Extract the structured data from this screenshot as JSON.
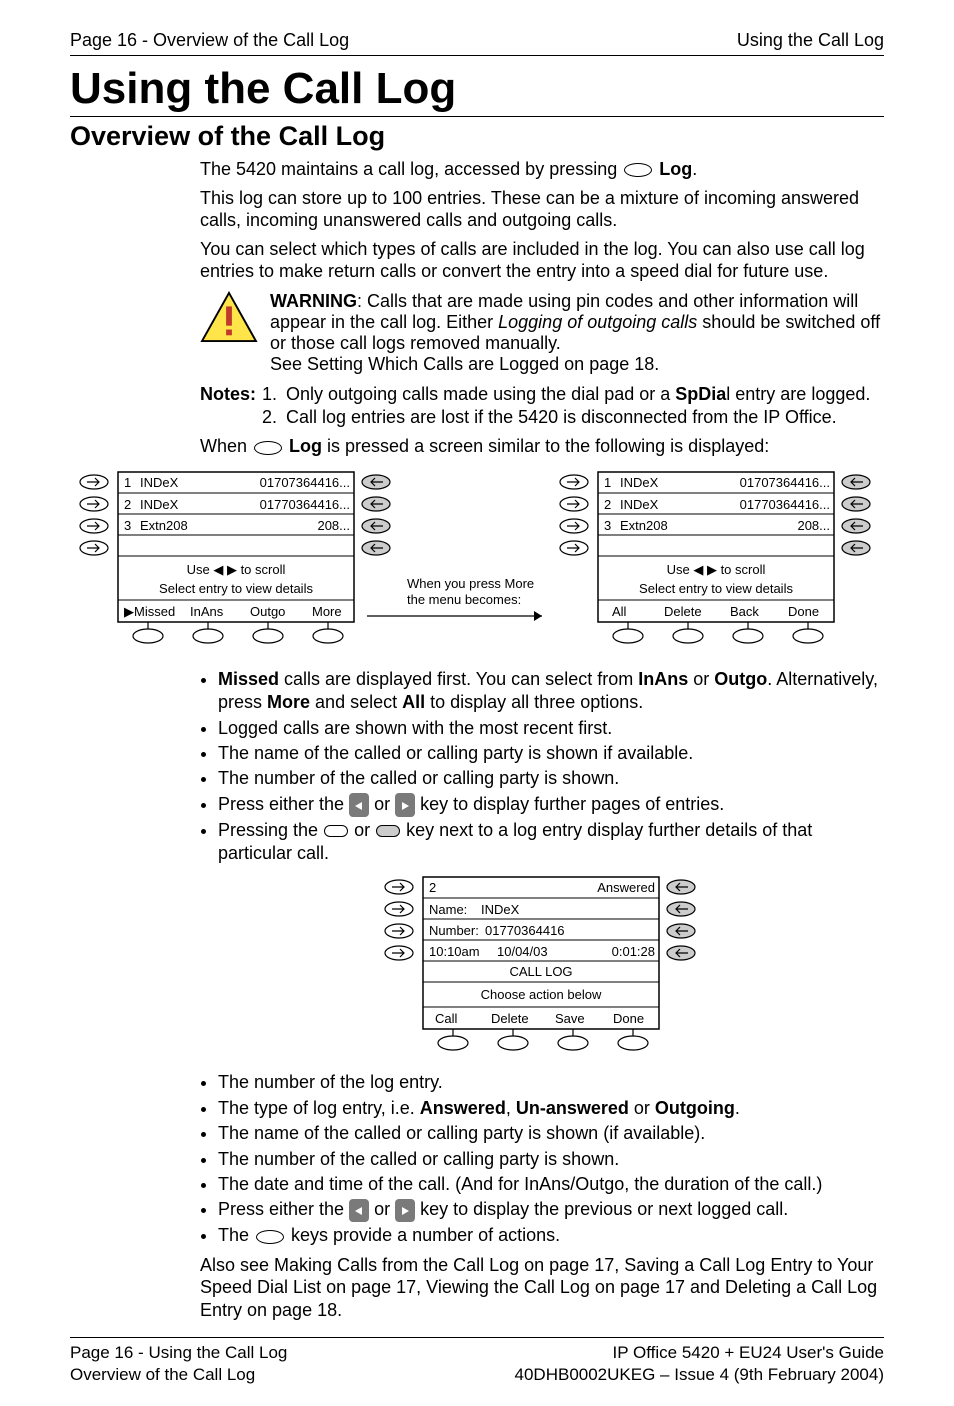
{
  "header": {
    "left": "Page 16 - Overview of the Call Log",
    "right": "Using the Call Log"
  },
  "h1": "Using the Call Log",
  "h2": "Overview of the Call Log",
  "p1a": "The 5420 maintains a call log, accessed by pressing ",
  "p1b": " Log",
  "p1c": ".",
  "p2": "This log can store up to 100 entries. These can be a mixture of incoming answered calls, incoming unanswered calls and outgoing calls.",
  "p3": "You can select which types of calls are included in the log. You can also use call log entries to make return calls or convert the entry into a speed dial for future use.",
  "warn1a": "WARNING",
  "warn1b": ": Calls that are made using pin codes and other information will appear in the call log. Either ",
  "warn1c": "Logging of outgoing calls",
  "warn1d": " should be switched off or those call logs removed manually.",
  "warn2": "See Setting Which Calls are Logged on page 18.",
  "notes_label": "Notes:",
  "note1a": "Only outgoing calls made using the dial pad or a ",
  "note1b": "SpDia",
  "note1c": "l entry are logged.",
  "note2": "Call log entries are lost if the 5420 is disconnected from the IP Office.",
  "p4a": "When ",
  "p4b": " Log",
  "p4c": " is pressed a screen similar to the following is displayed:",
  "bullets1": {
    "b1a": "Missed",
    "b1b": " calls are displayed first. You can select from ",
    "b1c": "InAns",
    "b1d": " or ",
    "b1e": "Outgo",
    "b1f": ". Alternatively, press ",
    "b1g": "More",
    "b1h": " and select ",
    "b1i": "All",
    "b1j": " to display all three options.",
    "b2": "Logged calls are shown with the most recent first.",
    "b3": "The name of the called or calling party is shown if available.",
    "b4": "The number of the called or calling party is shown.",
    "b5a": "Press either the ",
    "b5b": " or ",
    "b5c": " key to display further pages of entries.",
    "b6a": "Pressing the ",
    "b6b": " or ",
    "b6c": " key next to a log entry display further details of that particular call."
  },
  "bullets2": {
    "b1": "The number of the log entry.",
    "b2a": "The type of log entry, i.e. ",
    "b2b": "Answered",
    "b2c": ", ",
    "b2d": "Un-answered",
    "b2e": " or ",
    "b2f": "Outgoing",
    "b2g": ".",
    "b3": "The name of the called or calling party is shown (if available).",
    "b4": "The number of the called or calling party is shown.",
    "b5": "The date and time of the call. (And for InAns/Outgo, the duration of the call.)",
    "b6a": "Press either the ",
    "b6b": " or ",
    "b6c": " key to display the previous or next logged call.",
    "b7a": "The ",
    "b7b": " keys provide a number of actions."
  },
  "p5": "Also see Making Calls from the Call Log on page 17, Saving a Call Log Entry to Your Speed Dial List on page 17, Viewing the Call Log on page 17 and Deleting a Call Log Entry on page 18.",
  "footer": {
    "left1": "Page 16 - Using the Call Log",
    "left2": "Overview of the Call Log",
    "right1": "IP Office 5420 + EU24 User's Guide",
    "right2": "40DHB0002UKEG – Issue 4 (9th February 2004)"
  },
  "fig1": {
    "row1": {
      "idx": "1",
      "name": "INDeX",
      "num": "01707364416..."
    },
    "row2": {
      "idx": "2",
      "name": "INDeX",
      "num": "01770364416..."
    },
    "row3": {
      "idx": "3",
      "name": "Extn208",
      "num": "208..."
    },
    "hint1": "Use ◀ ▶ to scroll",
    "hint2": "Select entry to view details",
    "tabA": [
      "▶Missed",
      "InAns",
      "Outgo",
      "More"
    ],
    "mid1": "When you press More",
    "mid2": "the menu becomes:",
    "tabB": [
      "All",
      "Delete",
      "Back",
      "Done"
    ]
  },
  "fig2": {
    "idx": "2",
    "type": "Answered",
    "name_label": "Name:",
    "name_val": "INDeX",
    "num_label": "Number:",
    "num_val": "01770364416",
    "time": "10:10am",
    "date": "10/04/03",
    "dur": "0:01:28",
    "title": "CALL LOG",
    "hint": "Choose action below",
    "tabs": [
      "Call",
      "Delete",
      "Save",
      "Done"
    ]
  }
}
